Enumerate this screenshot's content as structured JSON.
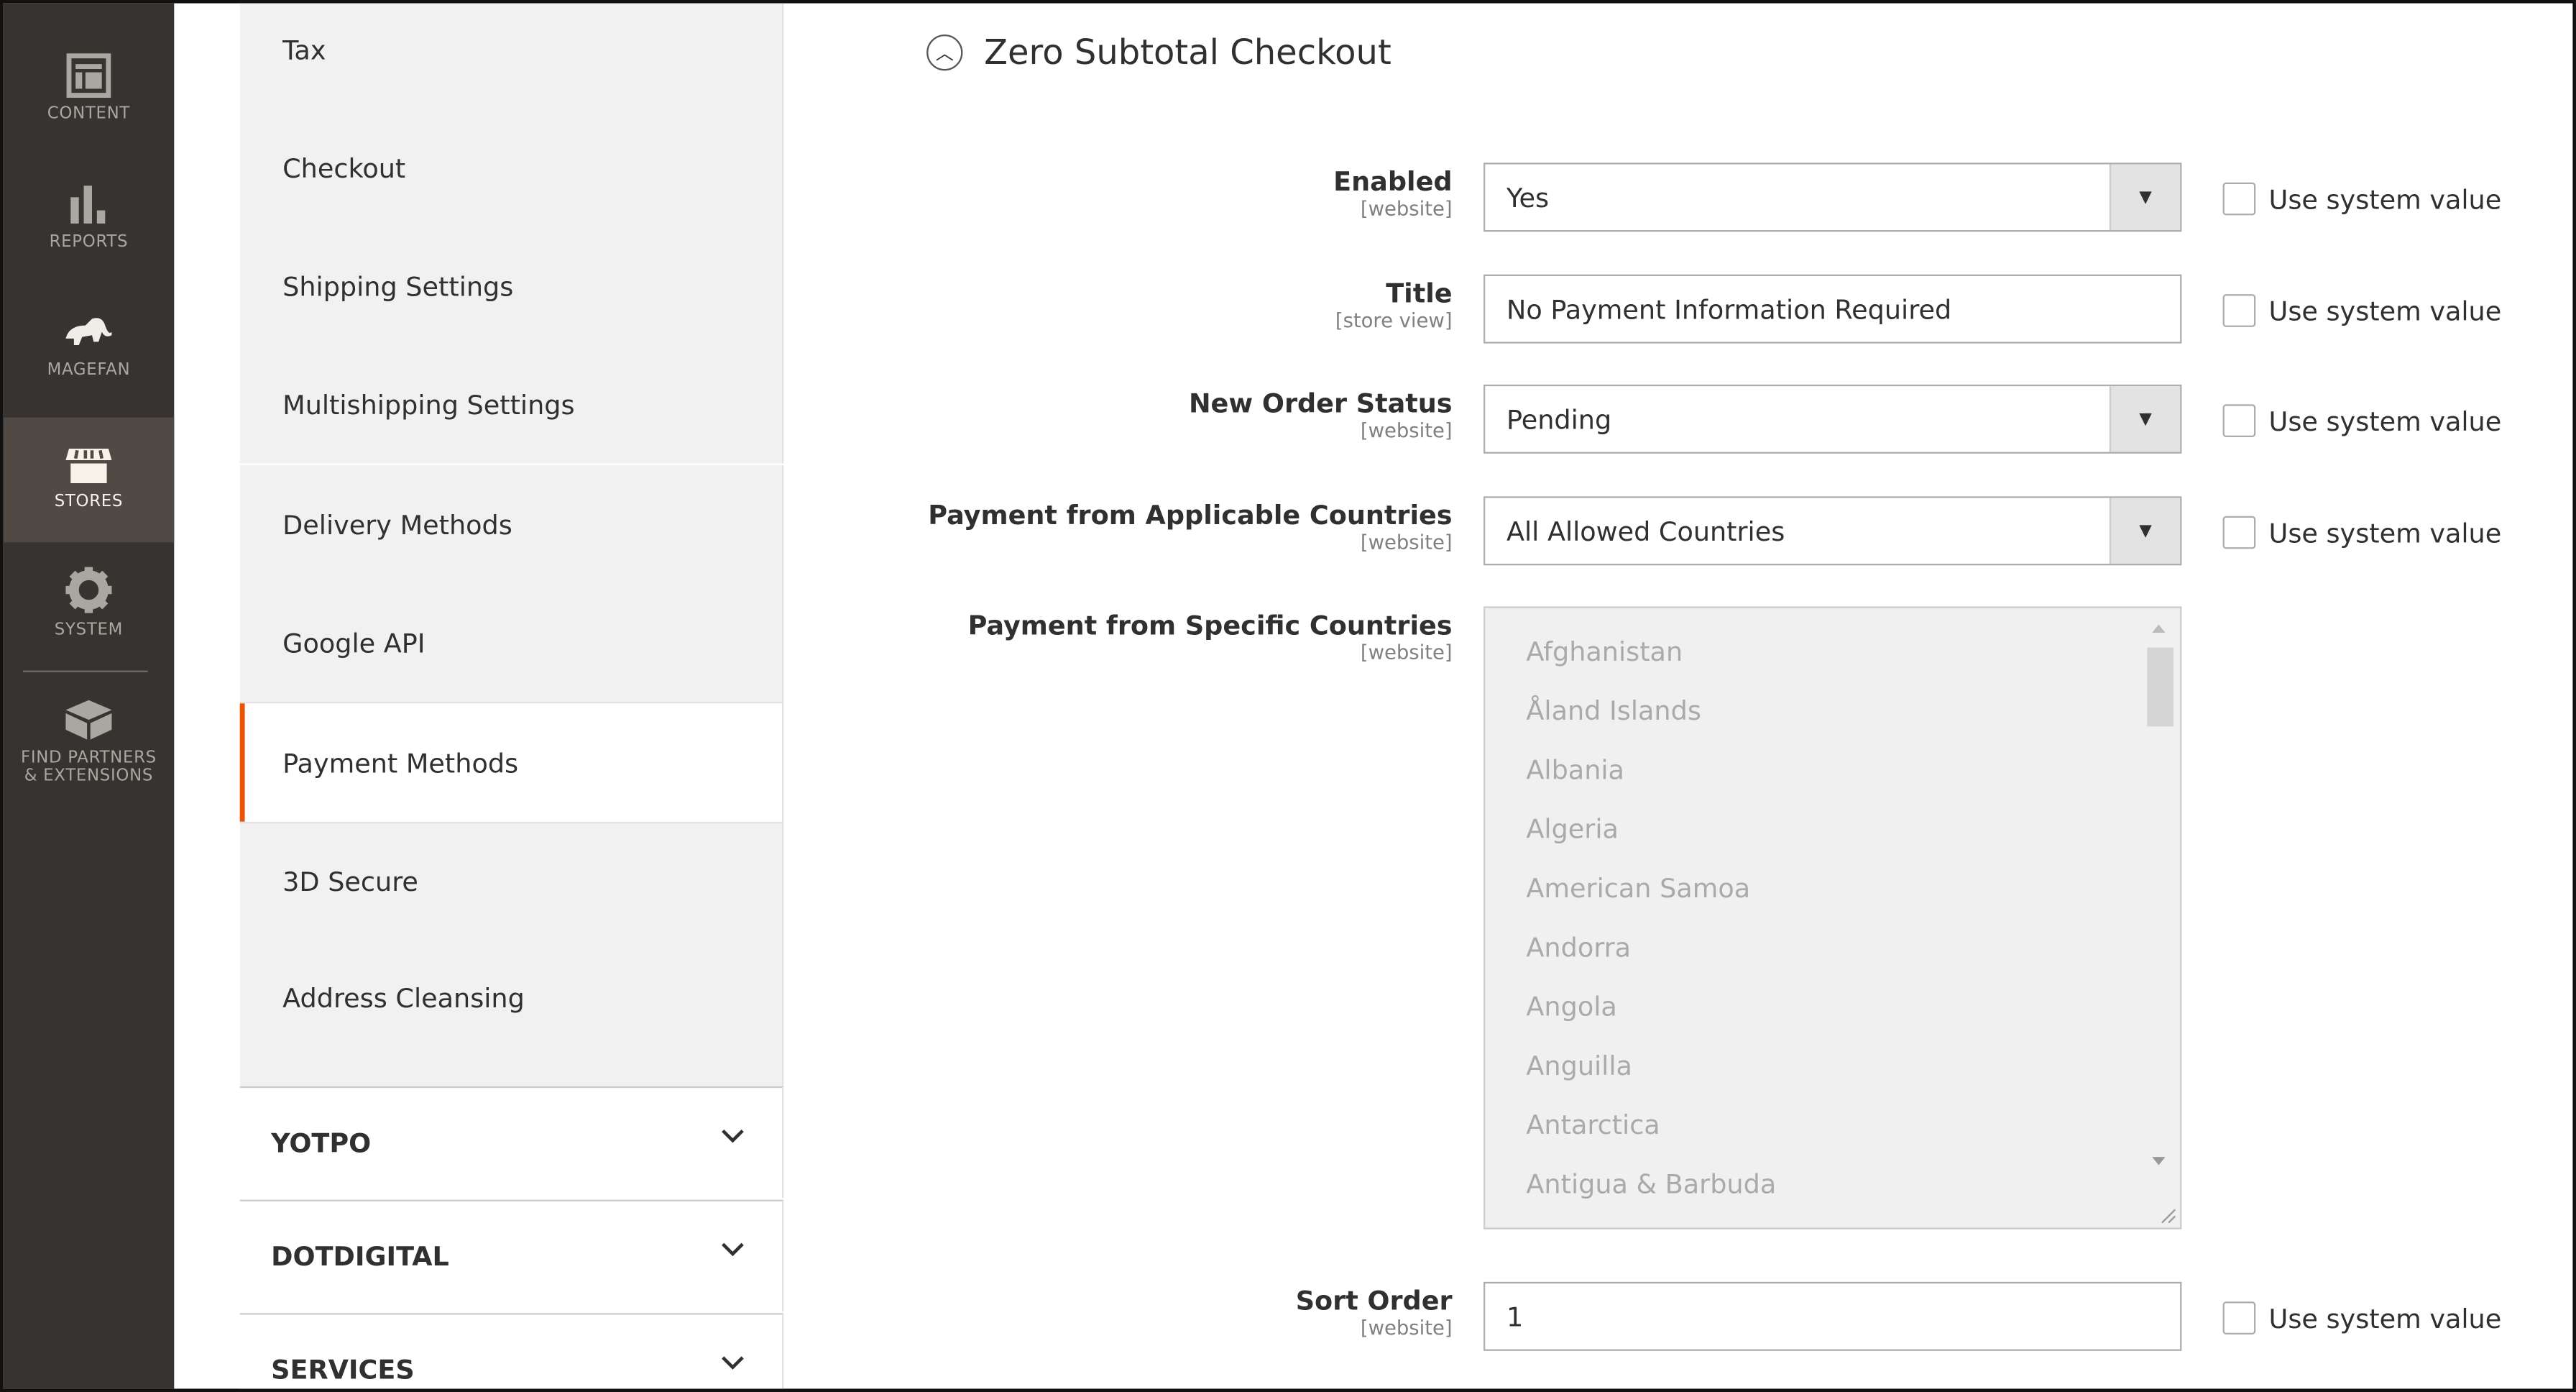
{
  "nav": [
    {
      "label": "CONTENT",
      "icon": "content-icon"
    },
    {
      "label": "REPORTS",
      "icon": "reports-icon"
    },
    {
      "label": "MAGEFAN",
      "icon": "magefan-elephant-icon"
    },
    {
      "label": "STORES",
      "icon": "stores-icon",
      "active": true
    },
    {
      "label": "SYSTEM",
      "icon": "gear-icon"
    },
    {
      "label": "FIND PARTNERS",
      "label2": "& EXTENSIONS",
      "icon": "extensions-box-icon"
    }
  ],
  "sidebar": {
    "items": [
      "Tax",
      "Checkout",
      "Shipping Settings",
      "Multishipping Settings",
      "Delivery Methods",
      "Google API",
      "Payment Methods",
      "3D Secure",
      "Address Cleansing"
    ],
    "active": "Payment Methods",
    "groups": [
      "YOTPO",
      "DOTDIGITAL",
      "SERVICES"
    ]
  },
  "accent": "#eb5202",
  "section": {
    "title": "Zero Subtotal Checkout"
  },
  "fields": [
    {
      "label": "Enabled",
      "scope": "[website]",
      "value": "Yes",
      "type": "select"
    },
    {
      "label": "Title",
      "scope": "[store view]",
      "value": "No Payment Information Required",
      "type": "text"
    },
    {
      "label": "New Order Status",
      "scope": "[website]",
      "value": "Pending",
      "type": "select"
    },
    {
      "label": "Payment from Applicable Countries",
      "scope": "[website]",
      "value": "All Allowed Countries",
      "type": "select"
    },
    {
      "label": "Payment from Specific Countries",
      "scope": "[website]",
      "type": "multiselect",
      "options": [
        "Afghanistan",
        "Åland Islands",
        "Albania",
        "Algeria",
        "American Samoa",
        "Andorra",
        "Angola",
        "Anguilla",
        "Antarctica",
        "Antigua & Barbuda"
      ]
    },
    {
      "label": "Sort Order",
      "scope": "[website]",
      "value": "1",
      "type": "text"
    }
  ],
  "use_system_value": "Use system value"
}
